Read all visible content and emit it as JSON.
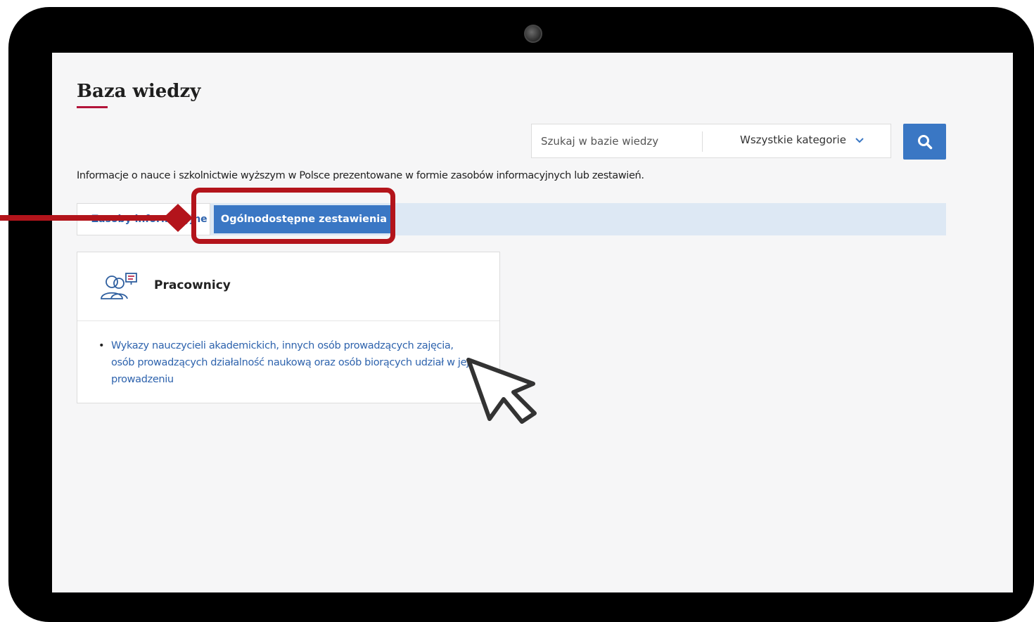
{
  "page": {
    "title": "Baza wiedzy",
    "intro": "Informacje o nauce i szkolnictwie wyższym w Polsce prezentowane w formie zasobów informacyjnych lub zestawień."
  },
  "search": {
    "placeholder": "Szukaj w bazie wiedzy",
    "category": "Wszystkie kategorie",
    "button_icon": "search-icon"
  },
  "tabs": [
    {
      "label": "Zasoby informacyjne",
      "active": false
    },
    {
      "label": "Ogólnodostępne zestawienia",
      "active": true
    }
  ],
  "card": {
    "icon": "people-presentation-icon",
    "title": "Pracownicy",
    "links": [
      "Wykazy nauczycieli akademickich, innych osób prowadzących zajęcia, osób prowadzących działalność naukową oraz osób biorących udział w jej prowadzeniu"
    ]
  },
  "colors": {
    "accent": "#3a77c4",
    "link": "#2e63ad",
    "title_underline": "#b3143a",
    "annotation": "#b3141b",
    "tab_bar": "#dde8f4"
  }
}
